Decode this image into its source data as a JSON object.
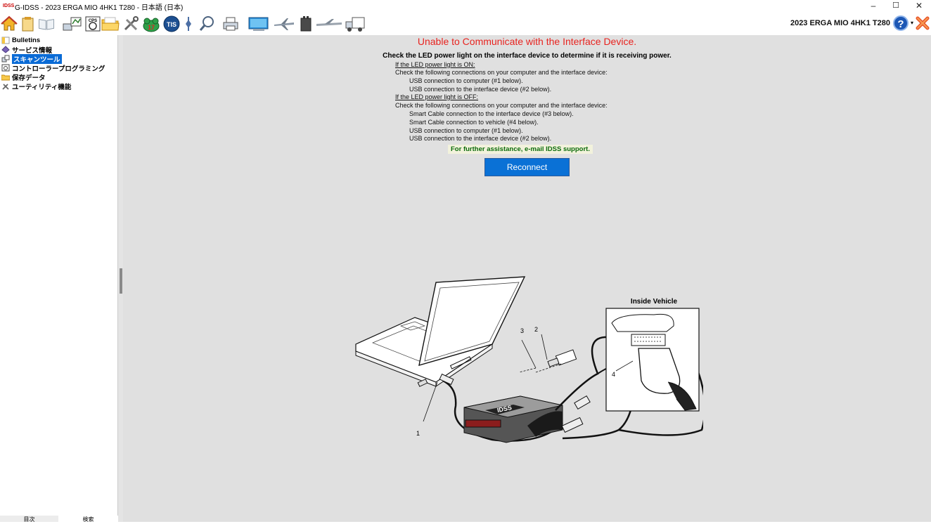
{
  "window": {
    "title": "G-IDSS - 2023 ERGA MIO 4HK1 T280 - 日本語 (日本)",
    "app_badge": "IDSS",
    "controls": [
      "–",
      "☐",
      "✕"
    ]
  },
  "toolbar": {
    "vehicle_label": "2023 ERGA MIO 4HK1 T280",
    "help_glyph": "?",
    "help_caret": "▾",
    "icons": [
      "home-icon",
      "notepad-icon",
      "book-icon",
      "diagnostic-network-icon",
      "cps-icon",
      "folder-icon",
      "tools-icon",
      "frog-icon",
      "tis-icon",
      "pin-icon",
      "search-icon",
      "printer-icon",
      "monitor-icon",
      "airplane-icon",
      "battery-icon",
      "plane-connect-icon",
      "truck-icon"
    ],
    "cps_text": "CPS",
    "tis_text": "TIS",
    "frog_number": "17"
  },
  "sidebar": {
    "items": [
      {
        "label": "Bulletins",
        "icon": "bulletin-icon"
      },
      {
        "label": "サービス情報",
        "icon": "service-info-icon"
      },
      {
        "label": "スキャンツール",
        "icon": "scan-tool-icon",
        "selected": true
      },
      {
        "label": "コントローラープログラミング",
        "icon": "controller-programming-icon"
      },
      {
        "label": "保存データ",
        "icon": "saved-data-icon"
      },
      {
        "label": "ユーティリティ機能",
        "icon": "utility-icon"
      }
    ],
    "bottom_tabs": [
      "目次",
      "検索"
    ]
  },
  "main": {
    "error_title": "Unable to Communicate with the Interface Device.",
    "lead": "Check the LED power light on the interface device to determine if it is receiving power.",
    "on_heading": "If the LED power light is ON:",
    "on_instruction": "Check the following connections on your computer and the interface device:",
    "on_items": [
      "USB connection to computer (#1 below).",
      "USB connection to the interface device (#2 below)."
    ],
    "off_heading": "If the LED power light is OFF:",
    "off_instruction": "Check the following connections on your computer and the interface device:",
    "off_items": [
      "Smart Cable connection to the interface device (#3 below).",
      "Smart Cable connection to vehicle (#4 below).",
      "USB connection to computer (#1 below).",
      "USB connection to the interface device (#2 below)."
    ],
    "assist_text": "For further assistance, e-mail IDSS support.",
    "reconnect_label": "Reconnect"
  },
  "diagram": {
    "inset_title": "Inside Vehicle",
    "callouts": [
      "1",
      "2",
      "3",
      "4"
    ],
    "device_label": "IDSS"
  },
  "colors": {
    "error": "#e8231f",
    "button": "#0a71d6",
    "selection": "#0a6bd6",
    "assist_text": "#0c6b0c",
    "panel_bg": "#e0e0e0"
  }
}
